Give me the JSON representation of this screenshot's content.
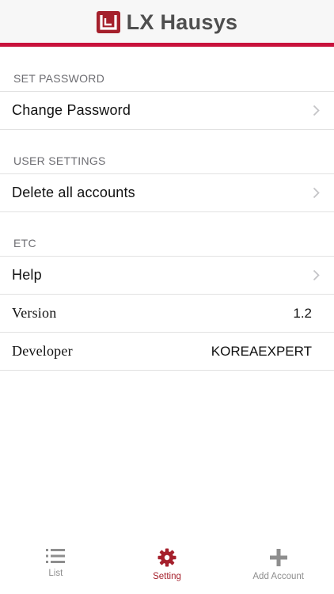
{
  "header": {
    "brand_text": "LX Hausys",
    "brand_color": "#c8123c",
    "logo_icon": "lx-logo-icon"
  },
  "sections": [
    {
      "title": "SET PASSWORD",
      "rows": [
        {
          "label": "Change Password",
          "value": "",
          "chevron": true
        }
      ]
    },
    {
      "title": "USER SETTINGS",
      "rows": [
        {
          "label": "Delete all accounts",
          "value": "",
          "chevron": true
        }
      ]
    },
    {
      "title": "ETC",
      "rows": [
        {
          "label": "Help",
          "value": "",
          "chevron": true
        },
        {
          "label": "Version",
          "value": "1.2",
          "chevron": false
        },
        {
          "label": "Developer",
          "value": "KOREAEXPERT",
          "chevron": false
        }
      ]
    }
  ],
  "tabbar": {
    "active_color": "#a5202c",
    "inactive_color": "#8e8e8e",
    "tabs": [
      {
        "label": "List",
        "icon": "list-icon",
        "active": false
      },
      {
        "label": "Setting",
        "icon": "gear-icon",
        "active": true
      },
      {
        "label": "Add Account",
        "icon": "plus-icon",
        "active": false
      }
    ]
  }
}
